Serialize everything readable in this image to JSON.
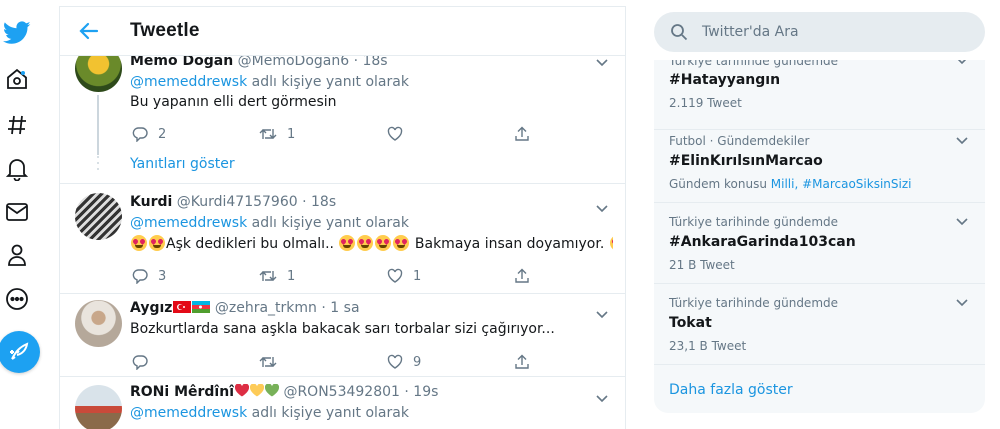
{
  "nav": {
    "items": [
      "twitter-logo",
      "home",
      "explore",
      "notifications",
      "messages",
      "profile",
      "more"
    ]
  },
  "header": {
    "title": "Tweetle"
  },
  "tweets": [
    {
      "name": "Memo Doğan",
      "handle": "@MemoDogan6",
      "time": "· 18s",
      "reply_prefix": "@memeddrewsk",
      "reply_suffix": " adlı kişiye yanıt olarak",
      "text": "Bu yapanın elli dert görmesin",
      "replies": "2",
      "retweets": "1",
      "likes": ""
    },
    {
      "name": "Kurdi",
      "handle": "@Kurdi47157960",
      "time": "· 18s",
      "reply_prefix": "@memeddrewsk",
      "reply_suffix": " adlı kişiye yanıt olarak",
      "text_a": "Aşk dedikleri bu olmalı..",
      "text_b": " Bakmaya insan doyamıyor.",
      "replies": "3",
      "retweets": "1",
      "likes": "1"
    },
    {
      "name": "Aygız",
      "handle": "@zehra_trkmn",
      "time": "· 1 sa",
      "text": "Bozkurtlarda sana aşkla bakacak sarı torbalar sizi çağırıyor...",
      "replies": "",
      "retweets": "",
      "likes": "9"
    },
    {
      "name": "RONi Mêrdînî",
      "handle": "@RON53492801",
      "time": "· 19s",
      "reply_prefix": "@memeddrewsk",
      "reply_suffix": " adlı kişiye yanıt olarak"
    }
  ],
  "show_replies": "Yanıtları göster",
  "search": {
    "placeholder": "Twitter'da Ara"
  },
  "trends": [
    {
      "category": "Türkiye tarihinde gündemde",
      "name": "#Hatayyangın",
      "meta": "2.119 Tweet"
    },
    {
      "category": "Futbol · Gündemdekiler",
      "name": "#ElinKırılsınMarcao",
      "meta_prefix": "Gündem konusu ",
      "meta_link": "Milli, #MarcaoSiksinSizi"
    },
    {
      "category": "Türkiye tarihinde gündemde",
      "name": "#AnkaraGarinda103can",
      "meta": "21 B Tweet"
    },
    {
      "category": "Türkiye tarihinde gündemde",
      "name": "Tokat",
      "meta": "23,1 B Tweet"
    }
  ],
  "show_more": "Daha fazla göster",
  "colors": {
    "accent": "#1da1f2",
    "link": "#1b95e0",
    "muted": "#657786",
    "border": "#e6ecf0"
  }
}
